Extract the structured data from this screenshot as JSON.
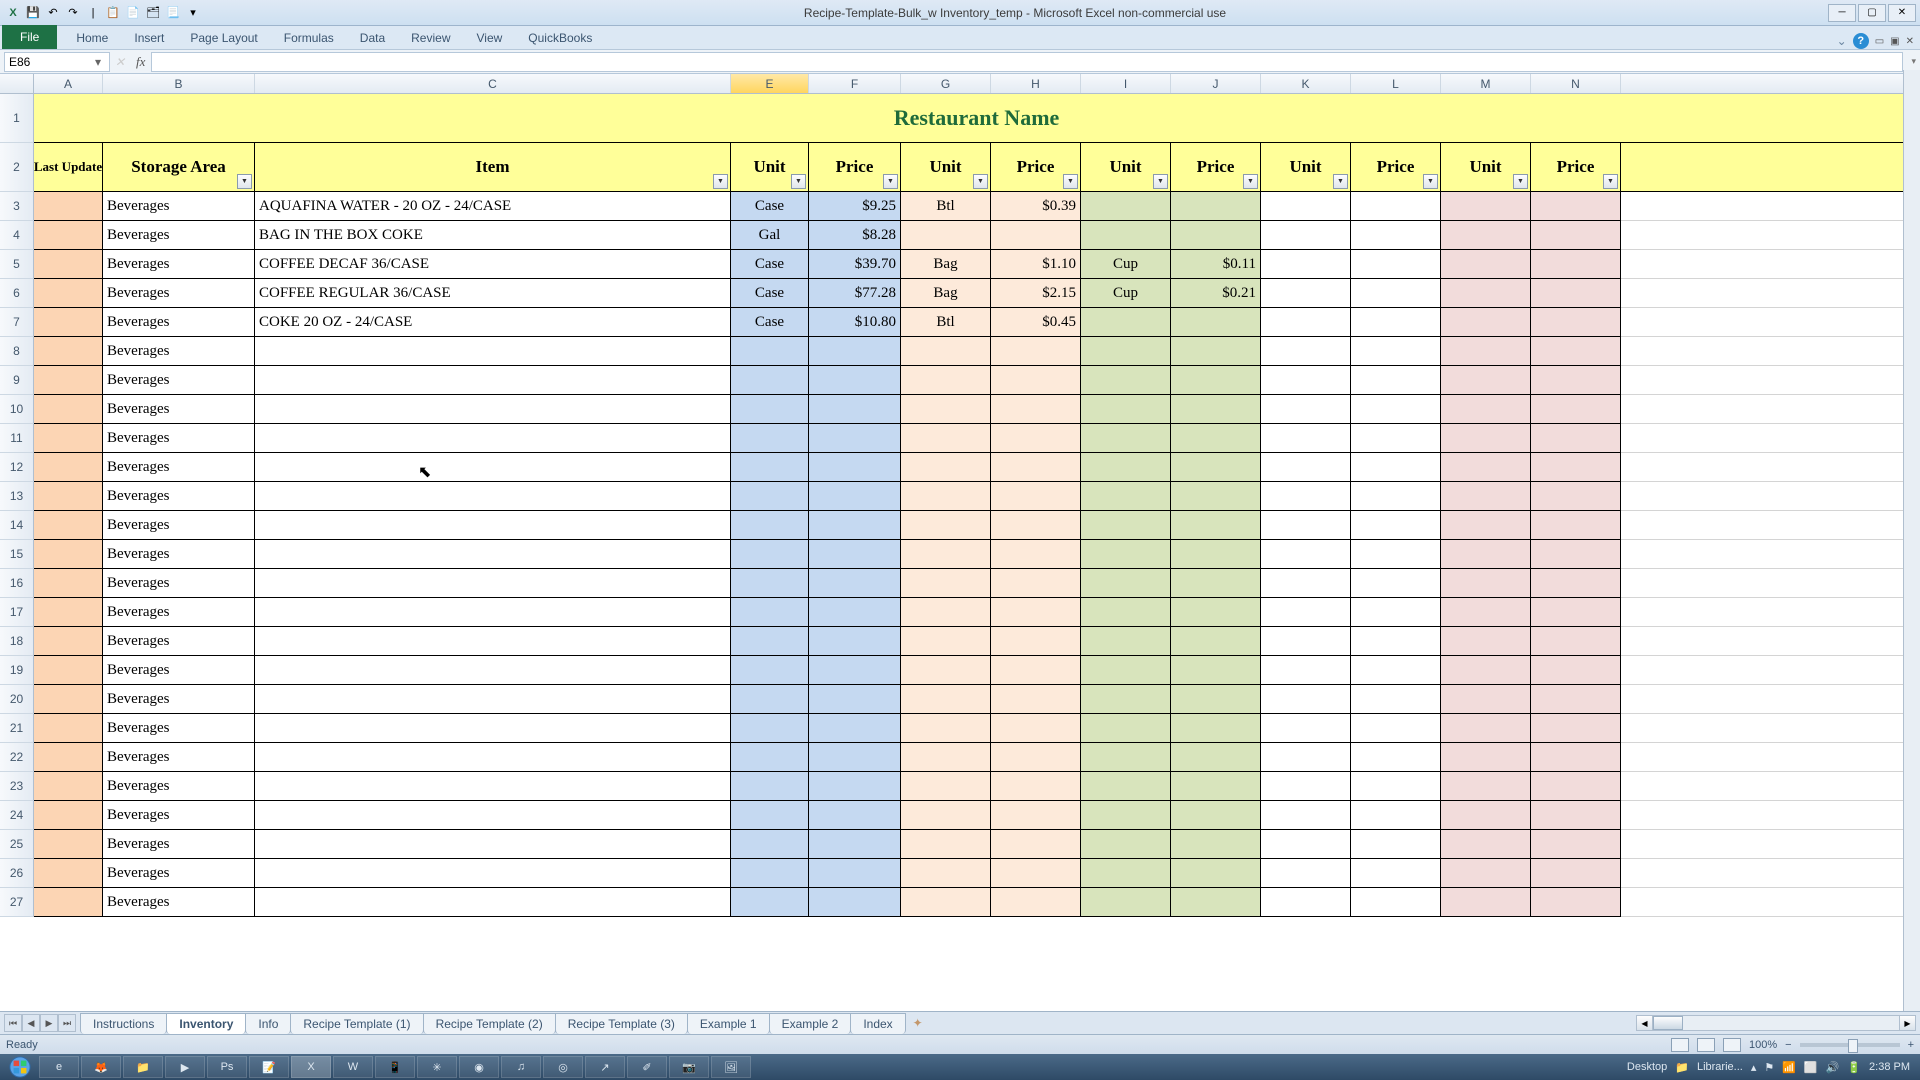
{
  "window": {
    "title": "Recipe-Template-Bulk_w Inventory_temp - Microsoft Excel non-commercial use"
  },
  "ribbon": {
    "file": "File",
    "tabs": [
      "Home",
      "Insert",
      "Page Layout",
      "Formulas",
      "Data",
      "Review",
      "View",
      "QuickBooks"
    ]
  },
  "formula_bar": {
    "name_box": "E86",
    "formula": ""
  },
  "columns": [
    "A",
    "B",
    "C",
    "E",
    "F",
    "G",
    "H",
    "I",
    "J",
    "K",
    "L",
    "M",
    "N"
  ],
  "selected_column": "E",
  "title_row": "Restaurant Name",
  "headers": {
    "A": "Last Update",
    "B": "Storage Area",
    "C": "Item",
    "pairs": [
      {
        "unit": "Unit",
        "price": "Price"
      },
      {
        "unit": "Unit",
        "price": "Price"
      },
      {
        "unit": "Unit",
        "price": "Price"
      },
      {
        "unit": "Unit",
        "price": "Price"
      },
      {
        "unit": "Unit",
        "price": "Price"
      }
    ]
  },
  "rows": [
    {
      "n": 3,
      "storage": "Beverages",
      "item": "AQUAFINA WATER - 20 OZ - 24/CASE",
      "u1": "Case",
      "p1": "$9.25",
      "u2": "Btl",
      "p2": "$0.39",
      "u3": "",
      "p3": ""
    },
    {
      "n": 4,
      "storage": "Beverages",
      "item": "BAG IN THE BOX COKE",
      "u1": "Gal",
      "p1": "$8.28",
      "u2": "",
      "p2": "",
      "u3": "",
      "p3": ""
    },
    {
      "n": 5,
      "storage": "Beverages",
      "item": "COFFEE DECAF 36/CASE",
      "u1": "Case",
      "p1": "$39.70",
      "u2": "Bag",
      "p2": "$1.10",
      "u3": "Cup",
      "p3": "$0.11"
    },
    {
      "n": 6,
      "storage": "Beverages",
      "item": "COFFEE REGULAR 36/CASE",
      "u1": "Case",
      "p1": "$77.28",
      "u2": "Bag",
      "p2": "$2.15",
      "u3": "Cup",
      "p3": "$0.21"
    },
    {
      "n": 7,
      "storage": "Beverages",
      "item": "COKE 20 OZ - 24/CASE",
      "u1": "Case",
      "p1": "$10.80",
      "u2": "Btl",
      "p2": "$0.45",
      "u3": "",
      "p3": ""
    },
    {
      "n": 8,
      "storage": "Beverages",
      "item": "",
      "u1": "",
      "p1": "",
      "u2": "",
      "p2": "",
      "u3": "",
      "p3": ""
    },
    {
      "n": 9,
      "storage": "Beverages",
      "item": "",
      "u1": "",
      "p1": "",
      "u2": "",
      "p2": "",
      "u3": "",
      "p3": ""
    },
    {
      "n": 10,
      "storage": "Beverages",
      "item": "",
      "u1": "",
      "p1": "",
      "u2": "",
      "p2": "",
      "u3": "",
      "p3": ""
    },
    {
      "n": 11,
      "storage": "Beverages",
      "item": "",
      "u1": "",
      "p1": "",
      "u2": "",
      "p2": "",
      "u3": "",
      "p3": ""
    },
    {
      "n": 12,
      "storage": "Beverages",
      "item": "",
      "u1": "",
      "p1": "",
      "u2": "",
      "p2": "",
      "u3": "",
      "p3": ""
    },
    {
      "n": 13,
      "storage": "Beverages",
      "item": "",
      "u1": "",
      "p1": "",
      "u2": "",
      "p2": "",
      "u3": "",
      "p3": ""
    },
    {
      "n": 14,
      "storage": "Beverages",
      "item": "",
      "u1": "",
      "p1": "",
      "u2": "",
      "p2": "",
      "u3": "",
      "p3": ""
    },
    {
      "n": 15,
      "storage": "Beverages",
      "item": "",
      "u1": "",
      "p1": "",
      "u2": "",
      "p2": "",
      "u3": "",
      "p3": ""
    },
    {
      "n": 16,
      "storage": "Beverages",
      "item": "",
      "u1": "",
      "p1": "",
      "u2": "",
      "p2": "",
      "u3": "",
      "p3": ""
    },
    {
      "n": 17,
      "storage": "Beverages",
      "item": "",
      "u1": "",
      "p1": "",
      "u2": "",
      "p2": "",
      "u3": "",
      "p3": ""
    },
    {
      "n": 18,
      "storage": "Beverages",
      "item": "",
      "u1": "",
      "p1": "",
      "u2": "",
      "p2": "",
      "u3": "",
      "p3": ""
    },
    {
      "n": 19,
      "storage": "Beverages",
      "item": "",
      "u1": "",
      "p1": "",
      "u2": "",
      "p2": "",
      "u3": "",
      "p3": ""
    },
    {
      "n": 20,
      "storage": "Beverages",
      "item": "",
      "u1": "",
      "p1": "",
      "u2": "",
      "p2": "",
      "u3": "",
      "p3": ""
    },
    {
      "n": 21,
      "storage": "Beverages",
      "item": "",
      "u1": "",
      "p1": "",
      "u2": "",
      "p2": "",
      "u3": "",
      "p3": ""
    },
    {
      "n": 22,
      "storage": "Beverages",
      "item": "",
      "u1": "",
      "p1": "",
      "u2": "",
      "p2": "",
      "u3": "",
      "p3": ""
    },
    {
      "n": 23,
      "storage": "Beverages",
      "item": "",
      "u1": "",
      "p1": "",
      "u2": "",
      "p2": "",
      "u3": "",
      "p3": ""
    },
    {
      "n": 24,
      "storage": "Beverages",
      "item": "",
      "u1": "",
      "p1": "",
      "u2": "",
      "p2": "",
      "u3": "",
      "p3": ""
    },
    {
      "n": 25,
      "storage": "Beverages",
      "item": "",
      "u1": "",
      "p1": "",
      "u2": "",
      "p2": "",
      "u3": "",
      "p3": ""
    },
    {
      "n": 26,
      "storage": "Beverages",
      "item": "",
      "u1": "",
      "p1": "",
      "u2": "",
      "p2": "",
      "u3": "",
      "p3": ""
    },
    {
      "n": 27,
      "storage": "Beverages",
      "item": "",
      "u1": "",
      "p1": "",
      "u2": "",
      "p2": "",
      "u3": "",
      "p3": ""
    }
  ],
  "sheet_tabs": [
    "Instructions",
    "Inventory",
    "Info",
    "Recipe Template (1)",
    "Recipe Template (2)",
    "Recipe Template (3)",
    "Example 1",
    "Example 2",
    "Index"
  ],
  "active_sheet": "Inventory",
  "status": {
    "ready": "Ready",
    "zoom": "100%"
  },
  "taskbar": {
    "desktop": "Desktop",
    "libraries": "Librarie...",
    "time": "2:38 PM"
  }
}
